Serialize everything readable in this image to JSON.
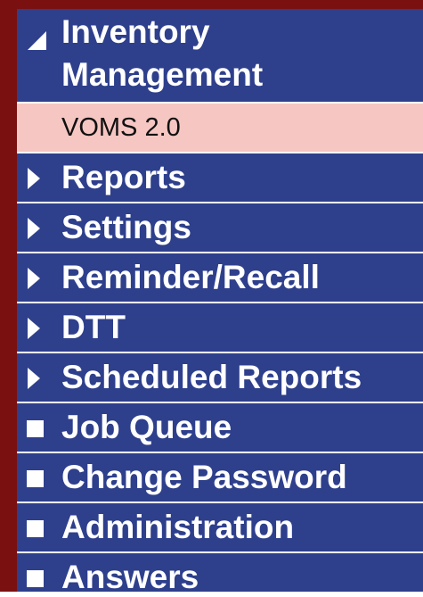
{
  "menu": {
    "items": [
      {
        "label_line1": "Inventory",
        "label_line2": "Management",
        "icon": "triangle-down-icon",
        "expanded": true
      },
      {
        "label": "VOMS 2.0",
        "type": "submenu"
      },
      {
        "label": "Reports",
        "icon": "triangle-right-icon"
      },
      {
        "label": "Settings",
        "icon": "triangle-right-icon"
      },
      {
        "label": "Reminder/Recall",
        "icon": "triangle-right-icon"
      },
      {
        "label": "DTT",
        "icon": "triangle-right-icon"
      },
      {
        "label": "Scheduled Reports",
        "icon": "triangle-right-icon"
      },
      {
        "label": "Job Queue",
        "icon": "square-bullet-icon"
      },
      {
        "label": "Change Password",
        "icon": "square-bullet-icon"
      },
      {
        "label": "Administration",
        "icon": "square-bullet-icon"
      },
      {
        "label": "Answers",
        "icon": "square-bullet-icon"
      }
    ]
  },
  "colors": {
    "item_background": "#2e3f8c",
    "submenu_background": "#f6c6c2",
    "frame": "#7a1010",
    "text": "#ffffff"
  }
}
